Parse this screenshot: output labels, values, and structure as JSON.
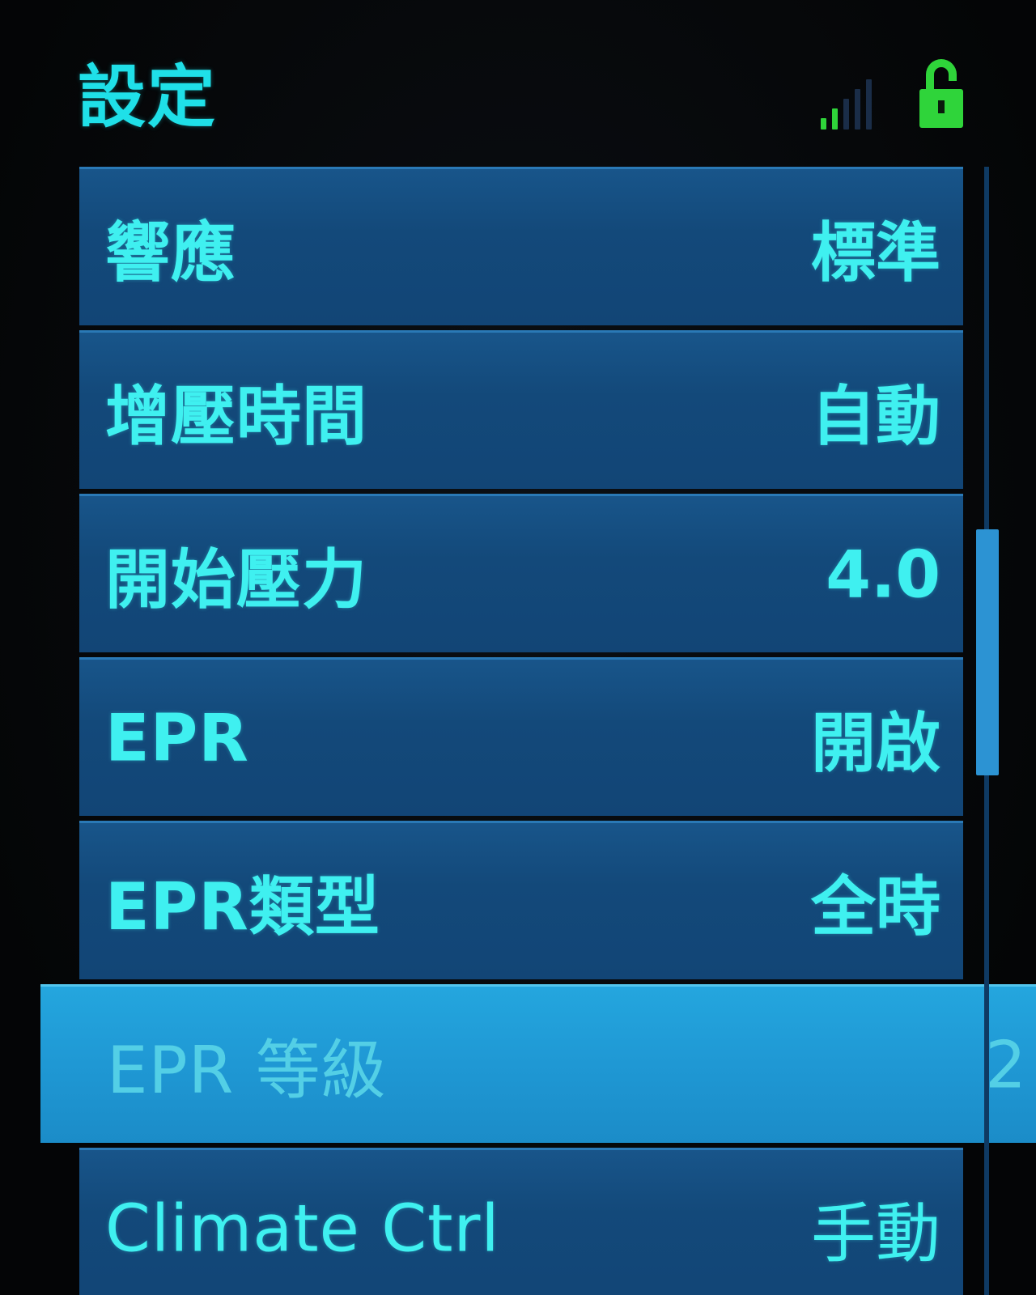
{
  "header": {
    "title": "設定",
    "status_icons": [
      "signal-strength-icon",
      "lock-icon"
    ]
  },
  "colors": {
    "text": "#3ff0f0",
    "row_bg": "#13497a",
    "selected_bg": "#1f98d4",
    "lock": "#2fd43a",
    "signal_active": "#2fd43a",
    "signal_inactive": "#1a2d48"
  },
  "menu": {
    "items": [
      {
        "label": "響應",
        "value": "標準"
      },
      {
        "label": "增壓時間",
        "value": "自動"
      },
      {
        "label": "開始壓力",
        "value": "4.0"
      },
      {
        "label": "EPR",
        "value": "開啟"
      },
      {
        "label": "EPR類型",
        "value": "全時"
      },
      {
        "label": "EPR 等級",
        "value": "2"
      },
      {
        "label": "Climate Ctrl",
        "value": "手動"
      }
    ],
    "selected_index": 5
  }
}
